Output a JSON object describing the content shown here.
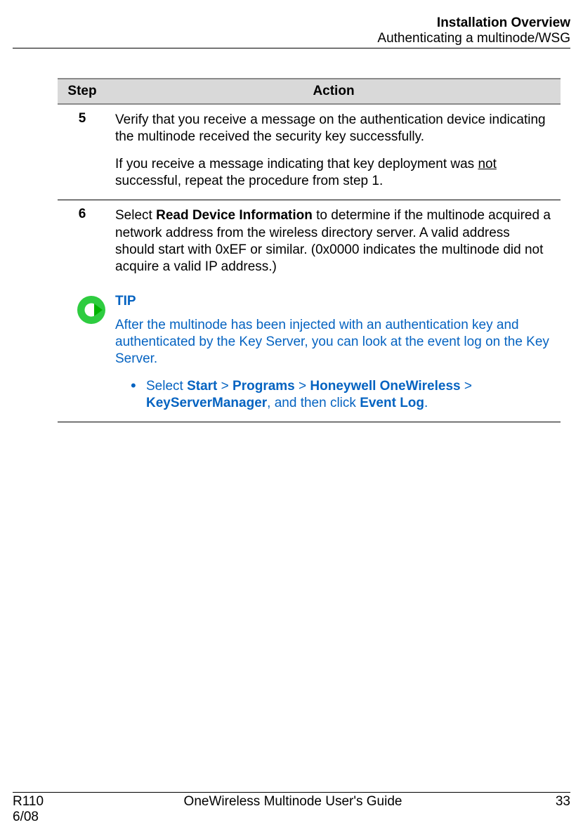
{
  "header": {
    "title": "Installation Overview",
    "subtitle": "Authenticating a multinode/WSG"
  },
  "table": {
    "headers": {
      "step": "Step",
      "action": "Action"
    },
    "rows": {
      "r5": {
        "num": "5",
        "p1": "Verify that you receive a message on the authentication device indicating the multinode received the security key successfully.",
        "p2_a": "If you receive a message indicating that key deployment was ",
        "p2_u": "not",
        "p2_b": " successful, repeat the procedure from step 1."
      },
      "r6": {
        "num": "6",
        "p1_a": "Select ",
        "p1_b": "Read Device Information",
        "p1_c": " to determine if the multinode acquired a network address from the wireless directory server.  A valid address should start with 0xEF or similar.  (0x0000 indicates the multinode did not acquire a valid IP address.)"
      },
      "tip": {
        "title": "TIP",
        "p1": "After the multinode has been injected with an authentication key and authenticated by the Key Server, you can look at the event log on the Key Server.",
        "li_a": "Select ",
        "li_start": "Start",
        "li_gt1": " > ",
        "li_programs": "Programs",
        "li_gt2": " > ",
        "li_hon": "Honeywell OneWireless",
        "li_gt3": " > ",
        "li_ksm": "KeyServerManager",
        "li_mid": ", and then click ",
        "li_el": "Event Log",
        "li_end": "."
      }
    }
  },
  "footer": {
    "left1": "R110",
    "left2": "6/08",
    "center": "OneWireless Multinode User's Guide",
    "right": "33"
  }
}
